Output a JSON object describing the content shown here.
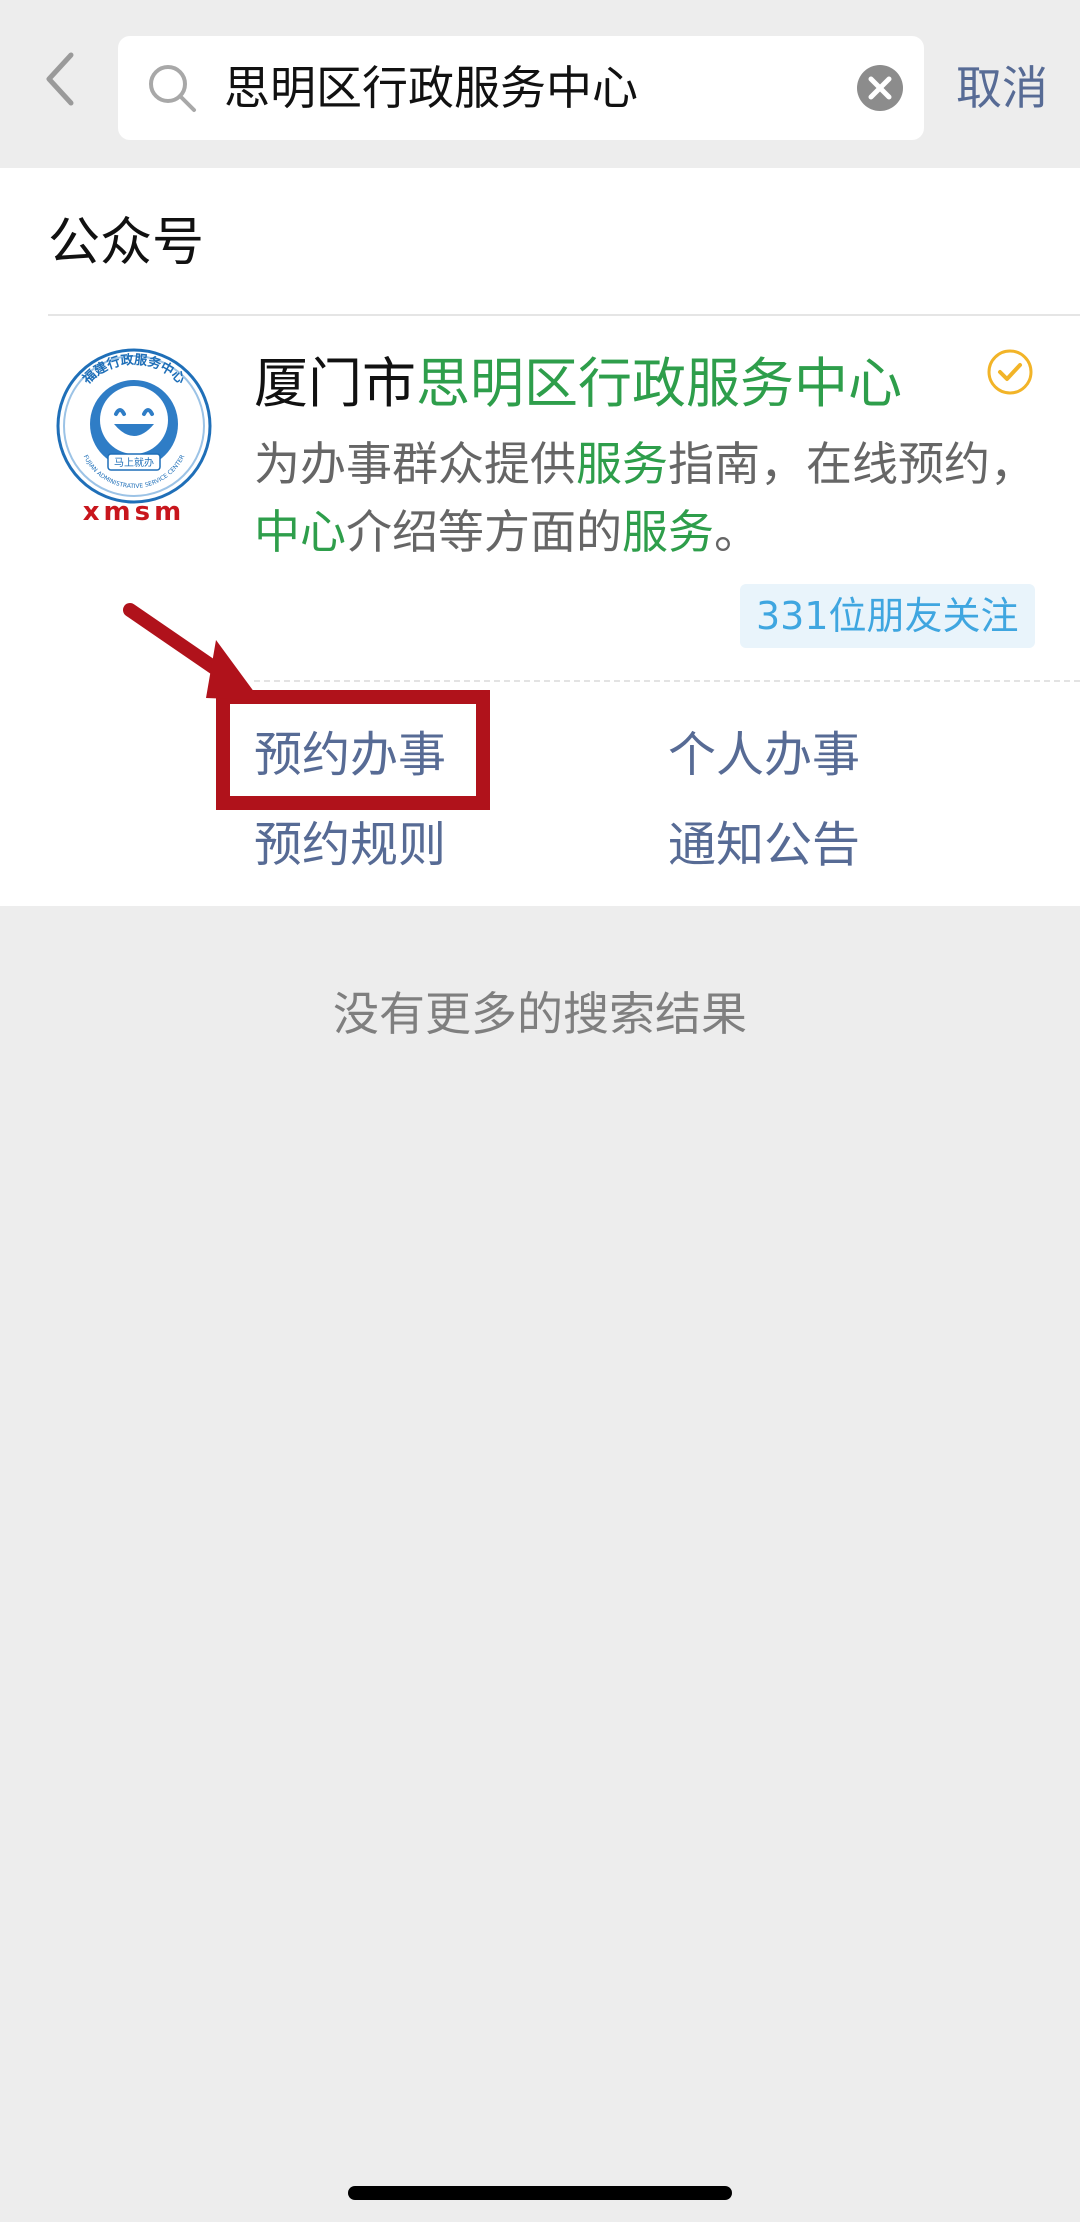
{
  "search": {
    "query": "思明区行政服务中心",
    "cancel_label": "取消"
  },
  "results": {
    "section_title": "公众号",
    "account": {
      "name_prefix": "厦门市",
      "name_highlight": "思明区行政服务中心",
      "description_parts": [
        {
          "text": "为办事群众提供",
          "highlight": false
        },
        {
          "text": "服务",
          "highlight": true
        },
        {
          "text": "指南，在线预约，",
          "highlight": false
        },
        {
          "text": "中心",
          "highlight": true
        },
        {
          "text": "介绍等方面的",
          "highlight": false
        },
        {
          "text": "服务",
          "highlight": true
        },
        {
          "text": "。",
          "highlight": false
        }
      ],
      "followers": "331位朋友关注",
      "logo": {
        "text_top": "福建行政服务中心",
        "text_bottom": "FUJIAN ADMINISTRATIVE SERVICE CENTER",
        "text_center": "马上就办",
        "text_under": "xmsm",
        "color": "#1f6fb8"
      }
    },
    "menu": [
      {
        "label": "预约办事"
      },
      {
        "label": "个人办事"
      },
      {
        "label": "预约规则"
      },
      {
        "label": "通知公告"
      }
    ],
    "no_more_text": "没有更多的搜索结果"
  },
  "colors": {
    "highlight": "#2e9e4b",
    "link": "#576b95",
    "annotation": "#b0121b",
    "verified": "#f2b428"
  }
}
